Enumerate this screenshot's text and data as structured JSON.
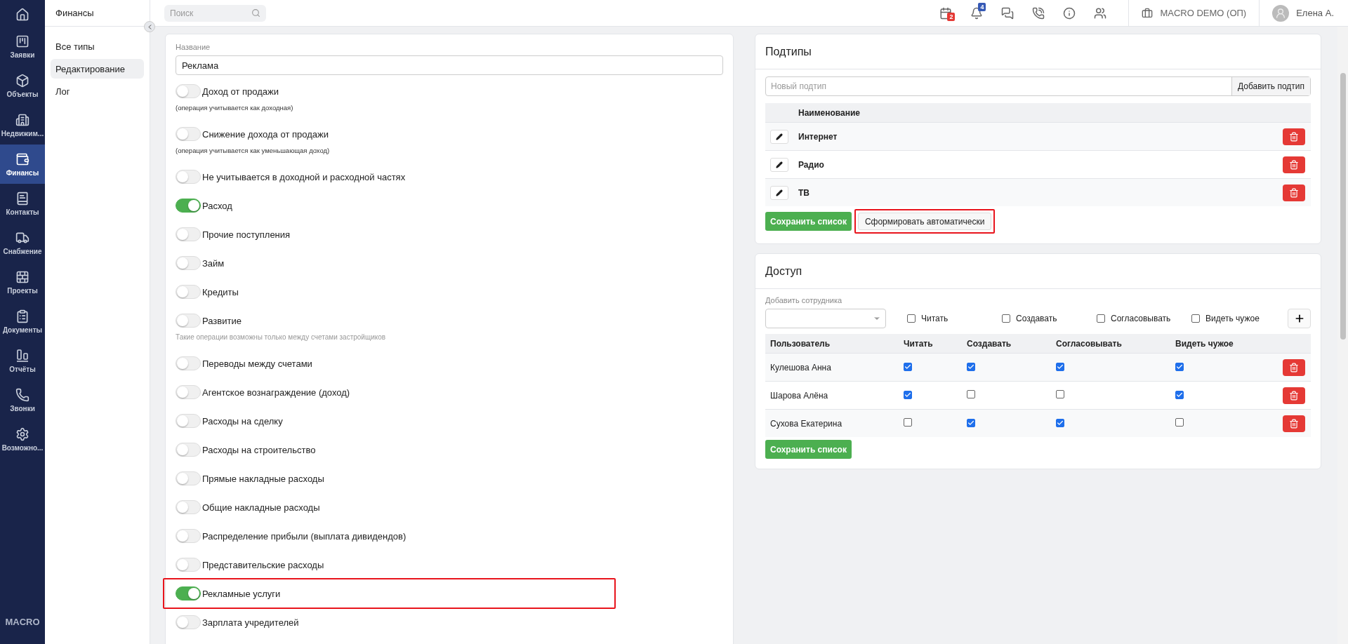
{
  "nav": {
    "items": [
      {
        "label": "Заявки",
        "selected": false
      },
      {
        "label": "Объекты",
        "selected": false
      },
      {
        "label": "Недвижим...",
        "selected": false
      },
      {
        "label": "Финансы",
        "selected": true
      },
      {
        "label": "Контакты",
        "selected": false
      },
      {
        "label": "Снабжение",
        "selected": false
      },
      {
        "label": "Проекты",
        "selected": false
      },
      {
        "label": "Документы",
        "selected": false
      },
      {
        "label": "Отчёты",
        "selected": false
      },
      {
        "label": "Звонки",
        "selected": false
      },
      {
        "label": "Возможно...",
        "selected": false
      }
    ],
    "brand": "MACRO"
  },
  "submenu": {
    "title": "Финансы",
    "items": [
      {
        "label": "Все типы",
        "selected": false
      },
      {
        "label": "Редактирование",
        "selected": true
      },
      {
        "label": "Лог",
        "selected": false
      }
    ]
  },
  "topbar": {
    "search": {
      "placeholder": "Поиск"
    },
    "calendar_badge": "2",
    "notifications_badge": "4",
    "company": "MACRO DEMO (ОП)",
    "user": "Елена А."
  },
  "form": {
    "name_label": "Название",
    "name_value": "Реклама",
    "toggles": [
      {
        "label": "Доход от продажи",
        "on": false,
        "highlighted": false,
        "note": {
          "text": "(операция учитывается как доходная)",
          "muted": false
        }
      },
      {
        "label": "Снижение дохода от продажи",
        "on": false,
        "highlighted": false,
        "note": {
          "text": "(операция учитывается как уменьшающая доход)",
          "muted": false
        }
      },
      {
        "label": "Не учитывается в доходной и расходной частях",
        "on": false,
        "highlighted": false
      },
      {
        "label": "Расход",
        "on": true,
        "highlighted": false
      },
      {
        "label": "Прочие поступления",
        "on": false,
        "highlighted": false
      },
      {
        "label": "Займ",
        "on": false,
        "highlighted": false
      },
      {
        "label": "Кредиты",
        "on": false,
        "highlighted": false
      },
      {
        "label": "Развитие",
        "on": false,
        "highlighted": false,
        "note": {
          "text": "Такие операции возможны только между счетами застройщиков",
          "muted": true
        }
      },
      {
        "label": "Переводы между счетами",
        "on": false,
        "highlighted": false
      },
      {
        "label": "Агентское вознаграждение (доход)",
        "on": false,
        "highlighted": false
      },
      {
        "label": "Расходы на сделку",
        "on": false,
        "highlighted": false
      },
      {
        "label": "Расходы на строительство",
        "on": false,
        "highlighted": false
      },
      {
        "label": "Прямые накладные расходы",
        "on": false,
        "highlighted": false
      },
      {
        "label": "Общие накладные расходы",
        "on": false,
        "highlighted": false
      },
      {
        "label": "Распределение прибыли (выплата дивидендов)",
        "on": false,
        "highlighted": false
      },
      {
        "label": "Представительские расходы",
        "on": false,
        "highlighted": false
      },
      {
        "label": "Рекламные услуги",
        "on": true,
        "highlighted": true
      },
      {
        "label": "Зарплата учредителей",
        "on": false,
        "highlighted": false
      }
    ]
  },
  "subtypes": {
    "title": "Подтипы",
    "new_placeholder": "Новый подтип",
    "add_button": "Добавить подтип",
    "column": "Наименование",
    "rows": [
      {
        "name": "Интернет"
      },
      {
        "name": "Радио"
      },
      {
        "name": "ТВ"
      }
    ],
    "save_button": "Сохранить список",
    "auto_button": {
      "label": "Сформировать автоматически",
      "highlighted": true
    }
  },
  "access": {
    "title": "Доступ",
    "add_label": "Добавить сотрудника",
    "filters": [
      {
        "label": "Читать",
        "checked": false
      },
      {
        "label": "Создавать",
        "checked": false
      },
      {
        "label": "Согласовывать",
        "checked": false
      },
      {
        "label": "Видеть чужое",
        "checked": false
      }
    ],
    "columns": [
      "Пользователь",
      "Читать",
      "Создавать",
      "Согласовывать",
      "Видеть чужое"
    ],
    "rows": [
      {
        "user": "Кулешова Анна",
        "permissions": [
          true,
          true,
          true,
          true
        ]
      },
      {
        "user": "Шарова Алёна",
        "permissions": [
          true,
          false,
          false,
          true
        ]
      },
      {
        "user": "Сухова Екатерина",
        "permissions": [
          false,
          true,
          true,
          false
        ]
      }
    ],
    "save_button": "Сохранить список"
  }
}
